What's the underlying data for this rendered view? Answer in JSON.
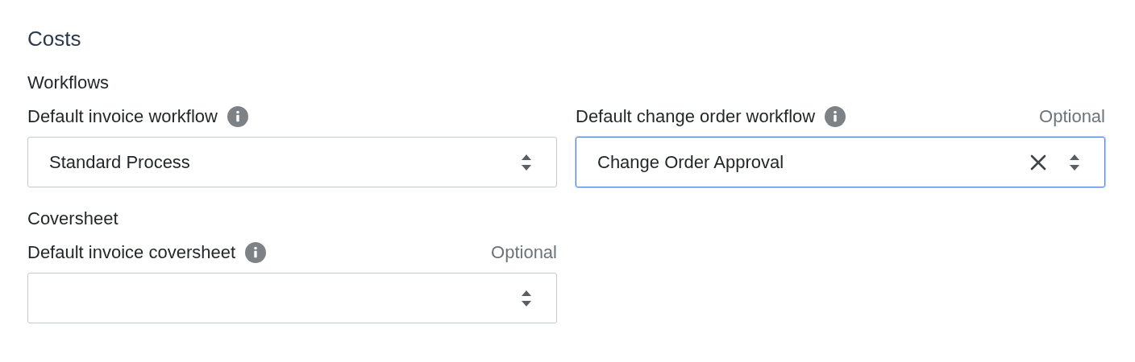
{
  "title": "Costs",
  "sections": [
    {
      "heading": "Workflows",
      "fields": [
        {
          "label": "Default invoice workflow",
          "value": "Standard Process",
          "focused": false,
          "clearable": false
        },
        {
          "label": "Default change order workflow",
          "optional": "Optional",
          "value": "Change Order Approval",
          "focused": true,
          "clearable": true
        }
      ]
    },
    {
      "heading": "Coversheet",
      "fields": [
        {
          "label": "Default invoice coversheet",
          "optional": "Optional",
          "focused": false,
          "clearable": false
        }
      ]
    }
  ]
}
